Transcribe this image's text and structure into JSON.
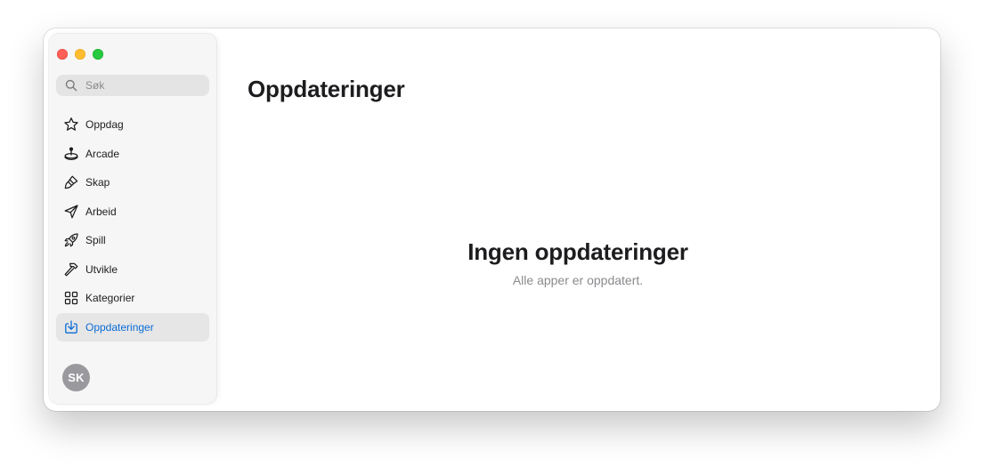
{
  "window": {
    "controls": [
      "close",
      "minimize",
      "zoom"
    ]
  },
  "sidebar": {
    "search": {
      "placeholder": "Søk",
      "value": "",
      "icon": "magnifying-glass-icon"
    },
    "items": [
      {
        "label": "Oppdag",
        "icon": "star-icon",
        "selected": false
      },
      {
        "label": "Arcade",
        "icon": "joystick-icon",
        "selected": false
      },
      {
        "label": "Skap",
        "icon": "paintbrush-icon",
        "selected": false
      },
      {
        "label": "Arbeid",
        "icon": "paperplane-icon",
        "selected": false
      },
      {
        "label": "Spill",
        "icon": "rocket-icon",
        "selected": false
      },
      {
        "label": "Utvikle",
        "icon": "hammer-icon",
        "selected": false
      },
      {
        "label": "Kategorier",
        "icon": "grid-icon",
        "selected": false
      },
      {
        "label": "Oppdateringer",
        "icon": "download-tray-icon",
        "selected": true
      }
    ],
    "account": {
      "initials": "SK"
    }
  },
  "main": {
    "title": "Oppdateringer",
    "empty_state": {
      "title": "Ingen oppdateringer",
      "subtitle": "Alle apper er oppdatert."
    }
  },
  "colors": {
    "accent": "#0a6cd6",
    "close": "#ff5f57",
    "minimize": "#febc2e",
    "zoom": "#28c840",
    "avatar": "#9a9a9e"
  }
}
